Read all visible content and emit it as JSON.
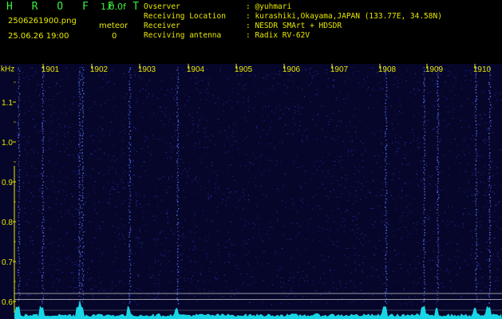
{
  "app": {
    "name": "H R O F F T",
    "version": "1.0.0f"
  },
  "file": {
    "name": "2506261900.png",
    "datetime": "25.06.26 19:00"
  },
  "meteor": {
    "label": "meteor",
    "count": "0"
  },
  "info": {
    "observer_label": "Ovserver",
    "observer_value": ": @yuhmari",
    "location_label": "Receiving Location",
    "location_value": ": kurashiki,Okayama,JAPAN (133.77E, 34.58N)",
    "receiver_label": "Receiver",
    "receiver_value": ": NESDR SMArt + HDSDR",
    "antenna_label": "Recviving antenna",
    "antenna_value": ": Radix RV-62V"
  },
  "chart_data": {
    "type": "heatmap",
    "ylabel": "kHz",
    "y_ticks": [
      "1.1",
      "1.0",
      "0.9",
      "0.8",
      "0.7",
      "0.6"
    ],
    "time_ticks": [
      "1901",
      "1902",
      "1903",
      "1904",
      "1905",
      "1906",
      "1907",
      "1908",
      "1909",
      "1910"
    ],
    "ylim": [
      0.58,
      1.2
    ],
    "reference_lines_khz": [
      0.62,
      0.605
    ],
    "colors": {
      "background": "#06062a",
      "speckle": "#2a3fd8",
      "streak": "#5a78ff",
      "spectrum": "#19d6e6",
      "text": "#e8e800",
      "refline": "#c8c8c8"
    }
  }
}
